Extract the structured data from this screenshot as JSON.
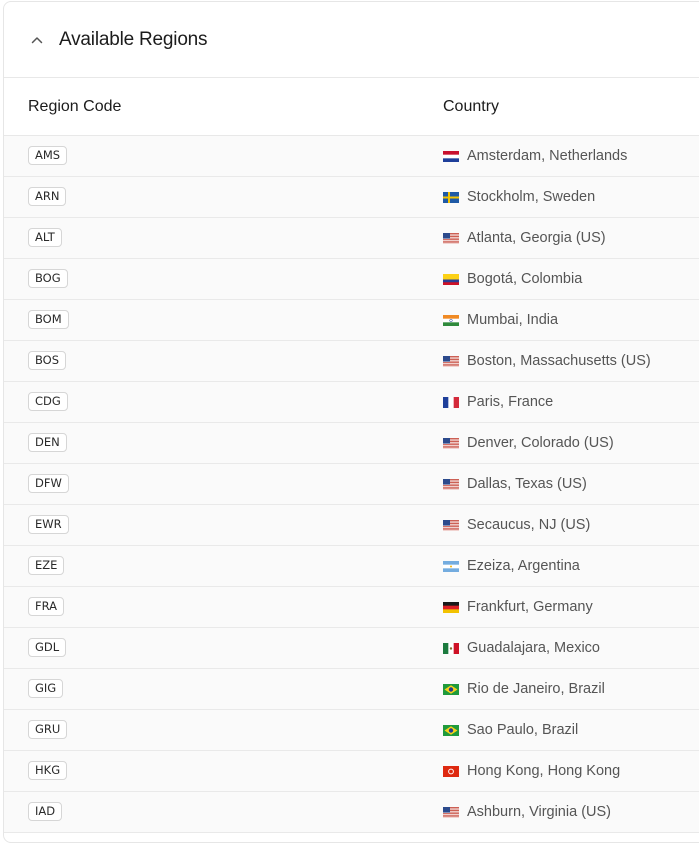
{
  "panel": {
    "title": "Available Regions"
  },
  "table": {
    "headers": {
      "code": "Region Code",
      "country": "Country"
    },
    "rows": [
      {
        "code": "AMS",
        "location": "Amsterdam, Netherlands",
        "flag": "nl"
      },
      {
        "code": "ARN",
        "location": "Stockholm, Sweden",
        "flag": "se"
      },
      {
        "code": "ALT",
        "location": "Atlanta, Georgia (US)",
        "flag": "us"
      },
      {
        "code": "BOG",
        "location": "Bogotá, Colombia",
        "flag": "co"
      },
      {
        "code": "BOM",
        "location": "Mumbai, India",
        "flag": "in"
      },
      {
        "code": "BOS",
        "location": "Boston, Massachusetts (US)",
        "flag": "us"
      },
      {
        "code": "CDG",
        "location": "Paris, France",
        "flag": "fr"
      },
      {
        "code": "DEN",
        "location": "Denver, Colorado (US)",
        "flag": "us"
      },
      {
        "code": "DFW",
        "location": "Dallas, Texas (US)",
        "flag": "us"
      },
      {
        "code": "EWR",
        "location": "Secaucus, NJ (US)",
        "flag": "us"
      },
      {
        "code": "EZE",
        "location": "Ezeiza, Argentina",
        "flag": "ar"
      },
      {
        "code": "FRA",
        "location": "Frankfurt, Germany",
        "flag": "de"
      },
      {
        "code": "GDL",
        "location": "Guadalajara, Mexico",
        "flag": "mx"
      },
      {
        "code": "GIG",
        "location": "Rio de Janeiro, Brazil",
        "flag": "br"
      },
      {
        "code": "GRU",
        "location": "Sao Paulo, Brazil",
        "flag": "br"
      },
      {
        "code": "HKG",
        "location": "Hong Kong, Hong Kong",
        "flag": "hk"
      },
      {
        "code": "IAD",
        "location": "Ashburn, Virginia (US)",
        "flag": "us"
      }
    ]
  }
}
